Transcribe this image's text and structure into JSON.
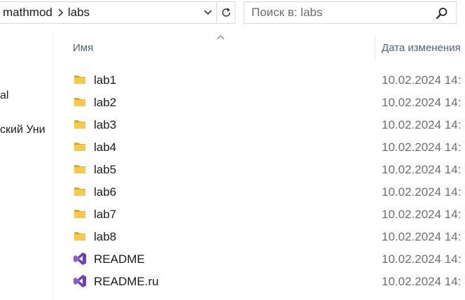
{
  "address_bar": {
    "crumbs": [
      "mathmod",
      "labs"
    ]
  },
  "search": {
    "placeholder": "Поиск в: labs"
  },
  "sidebar": {
    "items": [
      {
        "label": "al"
      },
      {
        "label": "ский Уни"
      }
    ]
  },
  "columns": {
    "name": "Имя",
    "date": "Дата изменения"
  },
  "files": [
    {
      "name": "lab1",
      "type": "folder",
      "date": "10.02.2024 14:"
    },
    {
      "name": "lab2",
      "type": "folder",
      "date": "10.02.2024 14:"
    },
    {
      "name": "lab3",
      "type": "folder",
      "date": "10.02.2024 14:"
    },
    {
      "name": "lab4",
      "type": "folder",
      "date": "10.02.2024 14:"
    },
    {
      "name": "lab5",
      "type": "folder",
      "date": "10.02.2024 14:"
    },
    {
      "name": "lab6",
      "type": "folder",
      "date": "10.02.2024 14:"
    },
    {
      "name": "lab7",
      "type": "folder",
      "date": "10.02.2024 14:"
    },
    {
      "name": "lab8",
      "type": "folder",
      "date": "10.02.2024 14:"
    },
    {
      "name": "README",
      "type": "visual-studio-file",
      "date": "10.02.2024 14:"
    },
    {
      "name": "README.ru",
      "type": "visual-studio-file",
      "date": "10.02.2024 14:"
    }
  ],
  "colors": {
    "folder": "#f7c948",
    "folder_dark": "#e3a82b",
    "vs_purple": "#6f3fb8",
    "header_text": "#4c607a"
  },
  "icons": {
    "breadcrumb_separator": "chevron-right-icon",
    "address_dropdown": "chevron-down-icon",
    "refresh": "refresh-icon",
    "search": "search-icon",
    "sort": "chevron-up-icon",
    "folder": "folder-icon",
    "visual_studio": "visual-studio-icon"
  }
}
